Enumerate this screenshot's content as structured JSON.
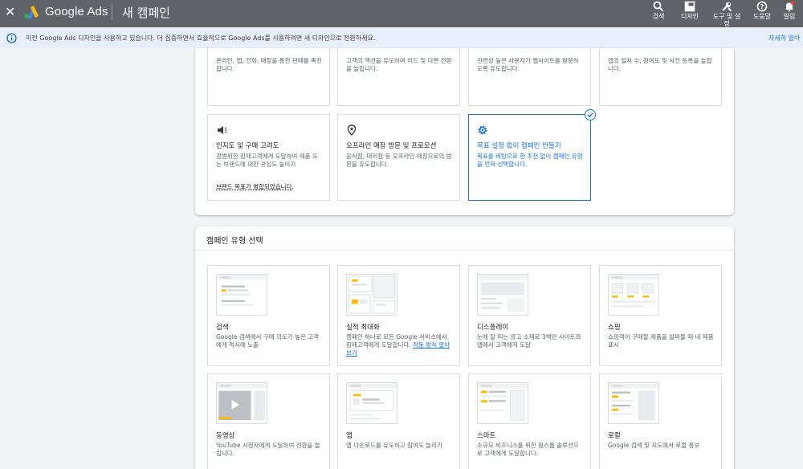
{
  "header": {
    "brand": "Google Ads",
    "page_title": "새 캠페인",
    "tools": [
      {
        "icon": "search-icon",
        "label": "검색"
      },
      {
        "icon": "appearance-icon",
        "label": "디자인"
      },
      {
        "icon": "wrench-icon",
        "label": "도구 및 설정"
      },
      {
        "icon": "help-icon",
        "label": "도움말"
      },
      {
        "icon": "bell-icon",
        "label": "알림"
      }
    ]
  },
  "banner": {
    "message": "이전 Google Ads 디자인을 사용하고 있습니다. 더 집중하면서 효율적으로 Google Ads를 사용하려면 새 디자인으로 전환하세요.",
    "link": "자세히 알아"
  },
  "goals": {
    "top_row": [
      {
        "desc": "온라인, 앱, 전화, 매장을 통한 판매를 촉진합니다."
      },
      {
        "desc": "고객의 액션을 유도하여 리드 및 다른 전환을 늘립니다."
      },
      {
        "desc": "관련성 높은 사용자가 웹사이트를 방문하도록 유도합니다."
      },
      {
        "desc": "앱의 설치 수, 참여도 및 사전 등록을 늘립니다."
      }
    ],
    "row2": [
      {
        "icon": "megaphone-icon",
        "title": "인지도 및 구매 고려도",
        "desc": "광범위한 잠재고객에게 도달하여 제품 또는 브랜드에 대한 관심도 높이기",
        "note": "브랜드 목표가 병합되었습니다."
      },
      {
        "icon": "location-pin-icon",
        "title": "오프라인 매장 방문 및 프로모션",
        "desc": "음식점, 대리점 등 오프라인 매장으로의 방문을 유도합니다."
      },
      {
        "icon": "gear-icon",
        "title": "목표 설정 없이 캠페인 만들기",
        "desc": "목표를 바탕으로 한 추천 없이 캠페인 유형을 먼저 선택합니다."
      }
    ]
  },
  "campaign_types": {
    "title": "캠페인 유형 선택",
    "row1": [
      {
        "title": "검색",
        "desc": "Google 검색에서 구매 의도가 높은 고객에게 적시에 노출"
      },
      {
        "title": "실적 최대화",
        "desc": "캠페인 하나로 모든 Google 서비스에서 잠재고객에게 도달합니다.",
        "link": "작동 방식 알아보기"
      },
      {
        "title": "디스플레이",
        "desc": "눈에 잘 띄는 광고 소재로 3백만 사이트와 앱에서 고객에게 도달"
      },
      {
        "title": "쇼핑",
        "desc": "쇼핑객이 구매할 제품을 살펴볼 때 내 제품 표시"
      }
    ],
    "row2": [
      {
        "title": "동영상",
        "desc": "YouTube 시청자에게 도달하여 전환을 늘립니다."
      },
      {
        "title": "앱",
        "desc": "앱 다운로드를 유도하고 참여도 늘리기"
      },
      {
        "title": "스마트",
        "desc": "소규모 비즈니스를 위한 원스톱 솔루션으로 고객에게 도달합니다."
      },
      {
        "title": "로컬",
        "desc": "Google 검색 및 지도에서 로컬 홍보"
      }
    ]
  },
  "colors": {
    "topbar": "#5f6368",
    "accent": "#1a73e8",
    "banner": "#e8f0fe",
    "thumb_accent": "#fbbc04"
  }
}
